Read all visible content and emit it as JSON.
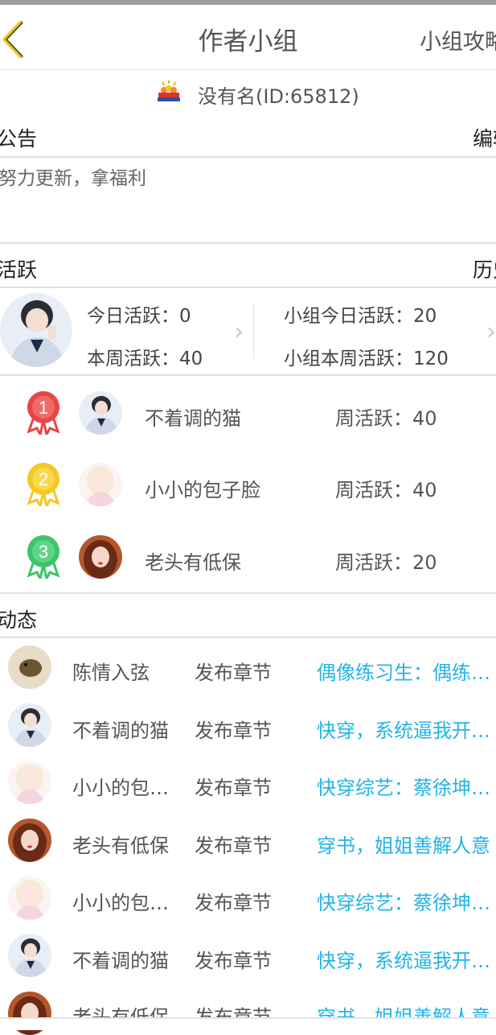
{
  "header": {
    "title": "作者小组",
    "right_label": "小组攻略"
  },
  "group": {
    "name": "没有名(ID:65812)"
  },
  "notice": {
    "title": "公告",
    "edit_label": "编辑",
    "text": "努力更新，拿福利"
  },
  "active": {
    "title": "活跃",
    "history_label": "历史",
    "today": "今日活跃：0",
    "week": "本周活跃：40",
    "group_today": "小组今日活跃：20",
    "group_week": "小组本周活跃：120"
  },
  "ranking": [
    {
      "rank": "1",
      "name": "不着调的猫",
      "value": "周活跃：40",
      "color": "#e84545"
    },
    {
      "rank": "2",
      "name": "小小的包子脸",
      "value": "周活跃：40",
      "color": "#f4c820"
    },
    {
      "rank": "3",
      "name": "老头有低保",
      "value": "周活跃：20",
      "color": "#3cc46a"
    }
  ],
  "feed": {
    "title": "动态",
    "items": [
      {
        "user": "陈情入弦",
        "action": "发布章节",
        "link": "偶像练习生：偶练小说"
      },
      {
        "user": "不着调的猫",
        "action": "发布章节",
        "link": "快穿，系统逼我开挂了"
      },
      {
        "user": "小小的包子脸",
        "action": "发布章节",
        "link": "快穿综艺：蔡徐坤粉丝"
      },
      {
        "user": "老头有低保",
        "action": "发布章节",
        "link": "穿书，姐姐善解人意"
      },
      {
        "user": "小小的包子脸",
        "action": "发布章节",
        "link": "快穿综艺：蔡徐坤粉丝"
      },
      {
        "user": "不着调的猫",
        "action": "发布章节",
        "link": "快穿，系统逼我开挂了"
      },
      {
        "user": "老头有低保",
        "action": "发布章节",
        "link": "穿书，姐姐善解人意"
      }
    ]
  },
  "colors": {
    "accent_yellow": "#f0c419",
    "link_blue": "#22b4e8",
    "divider": "#e0e0e0"
  }
}
